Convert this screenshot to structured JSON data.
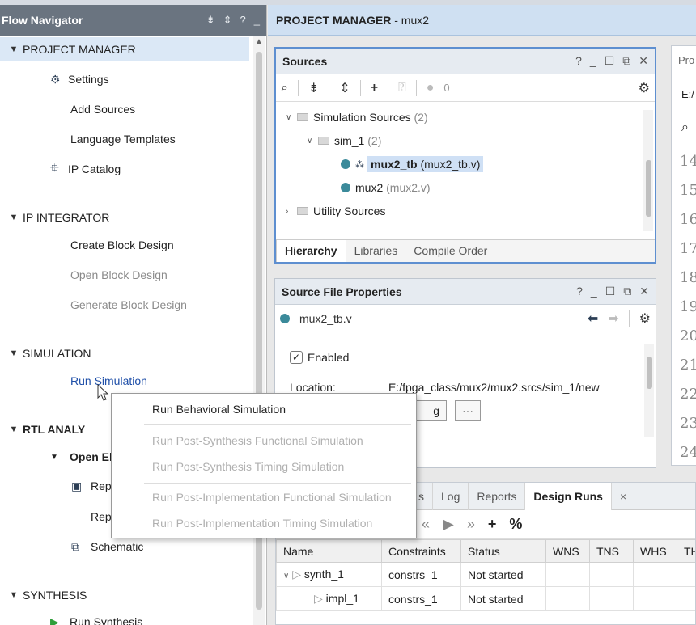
{
  "flow_navigator": {
    "title": "Flow Navigator",
    "tool_icons": [
      "collapse-all-icon",
      "expand-icon",
      "help-icon",
      "minimize-icon"
    ],
    "sections": [
      {
        "label": "PROJECT MANAGER",
        "items": [
          "Settings",
          "Add Sources",
          "Language Templates",
          "IP Catalog"
        ]
      },
      {
        "label": "IP INTEGRATOR",
        "items": [
          "Create Block Design",
          "Open Block Design",
          "Generate Block Design"
        ]
      },
      {
        "label": "SIMULATION",
        "items": [
          "Run Simulation"
        ]
      },
      {
        "label": "RTL ANALY",
        "items": [
          "Open El",
          "Rep",
          "Rep",
          "Schematic"
        ]
      },
      {
        "label": "SYNTHESIS",
        "items": [
          "Run Synthesis"
        ]
      }
    ]
  },
  "header": {
    "bold": "PROJECT MANAGER",
    "rest": " - mux2"
  },
  "sources": {
    "title": "Sources",
    "count": "0",
    "tree": [
      {
        "label": "Simulation Sources",
        "count": "(2)"
      },
      {
        "label": "sim_1",
        "count": "(2)"
      },
      {
        "label": "mux2_tb",
        "file": "(mux2_tb.v)"
      },
      {
        "label": "mux2",
        "file": "(mux2.v)"
      },
      {
        "label": "Utility Sources",
        "count": ""
      }
    ],
    "tabs": [
      "Hierarchy",
      "Libraries",
      "Compile Order"
    ]
  },
  "props": {
    "title": "Source File Properties",
    "file": "mux2_tb.v",
    "enabled_label": "Enabled",
    "location_label": "Location:",
    "location_value": "E:/fpga_class/mux2/mux2.srcs/sim_1/new",
    "btn_partial": "g",
    "more_btn": "···"
  },
  "code": {
    "header": "Pro",
    "path": "E:/",
    "lines": [
      "14",
      "15",
      "16",
      "17",
      "18",
      "19",
      "20",
      "21",
      "22",
      "23",
      "24"
    ]
  },
  "bottom": {
    "tabs": [
      "s",
      "Log",
      "Reports",
      "Design Runs"
    ],
    "close": "×",
    "columns": [
      "Name",
      "Constraints",
      "Status",
      "WNS",
      "TNS",
      "WHS",
      "TH"
    ],
    "rows": [
      {
        "name": "synth_1",
        "constraints": "constrs_1",
        "status": "Not started"
      },
      {
        "name": "impl_1",
        "constraints": "constrs_1",
        "status": "Not started"
      }
    ]
  },
  "menu": {
    "items": [
      {
        "label": "Run Behavioral Simulation",
        "enabled": true
      },
      {
        "label": "Run Post-Synthesis Functional Simulation",
        "enabled": false
      },
      {
        "label": "Run Post-Synthesis Timing Simulation",
        "enabled": false
      },
      {
        "label": "Run Post-Implementation Functional Simulation",
        "enabled": false
      },
      {
        "label": "Run Post-Implementation Timing Simulation",
        "enabled": false
      }
    ]
  },
  "colors": {
    "accent": "#5e8fd0",
    "nav_header": "#6a7480",
    "selected": "#dbe8f6",
    "link": "#1f4fa8"
  }
}
